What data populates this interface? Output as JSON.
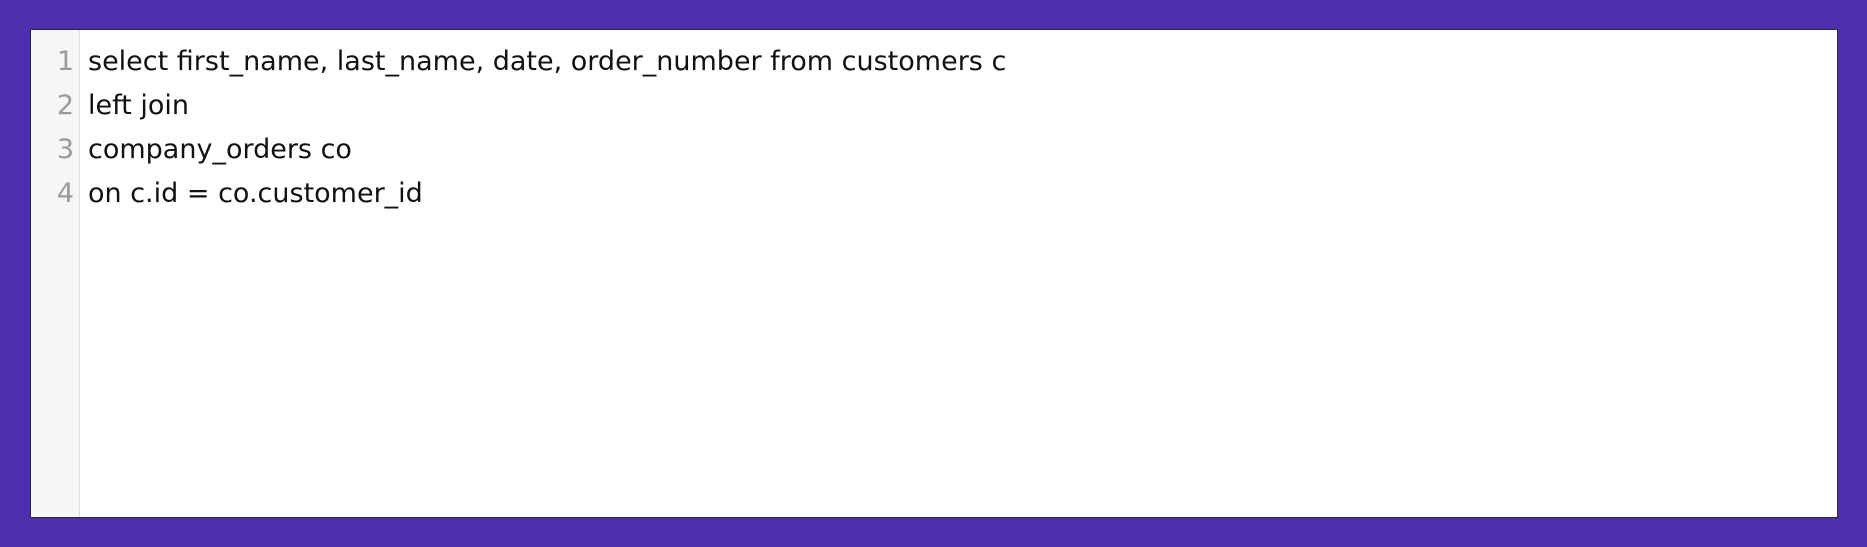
{
  "colors": {
    "background": "#4e2fb0",
    "editor_background": "#ffffff",
    "gutter_background": "#f6f6f6",
    "line_number_color": "#9a9a9a",
    "code_text_color": "#111111"
  },
  "editor": {
    "line_numbers": [
      "1",
      "2",
      "3",
      "4"
    ],
    "lines": [
      "select first_name, last_name, date, order_number from customers c",
      "left join",
      "company_orders co",
      "on c.id = co.customer_id"
    ]
  }
}
